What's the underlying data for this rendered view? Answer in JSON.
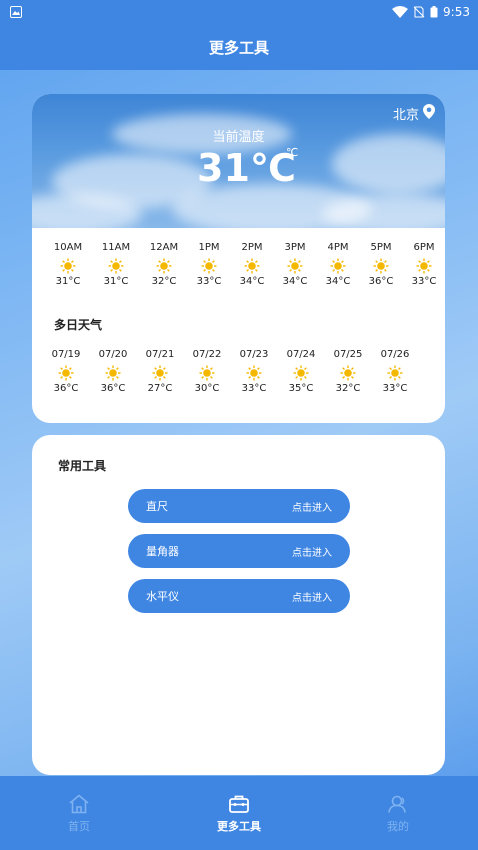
{
  "status_bar": {
    "time": "9:53"
  },
  "header": {
    "title": "更多工具"
  },
  "weather": {
    "city": "北京",
    "current_label": "当前温度",
    "current_temp": "31℃",
    "unit_small": "℃",
    "hourly": [
      {
        "time": "10AM",
        "temp": "31°C"
      },
      {
        "time": "11AM",
        "temp": "31°C"
      },
      {
        "time": "12AM",
        "temp": "32°C"
      },
      {
        "time": "1PM",
        "temp": "33°C"
      },
      {
        "time": "2PM",
        "temp": "34°C"
      },
      {
        "time": "3PM",
        "temp": "34°C"
      },
      {
        "time": "4PM",
        "temp": "34°C"
      },
      {
        "time": "5PM",
        "temp": "36°C"
      },
      {
        "time": "6PM",
        "temp": "33°C"
      }
    ],
    "multi_day_title": "多日天气",
    "daily": [
      {
        "date": "07/19",
        "temp": "36°C"
      },
      {
        "date": "07/20",
        "temp": "36°C"
      },
      {
        "date": "07/21",
        "temp": "27°C"
      },
      {
        "date": "07/22",
        "temp": "30°C"
      },
      {
        "date": "07/23",
        "temp": "33°C"
      },
      {
        "date": "07/24",
        "temp": "35°C"
      },
      {
        "date": "07/25",
        "temp": "32°C"
      },
      {
        "date": "07/26",
        "temp": "33°C"
      }
    ],
    "icon": "sun-icon"
  },
  "tools": {
    "title": "常用工具",
    "items": [
      {
        "name": "直尺",
        "action": "点击进入"
      },
      {
        "name": "量角器",
        "action": "点击进入"
      },
      {
        "name": "水平仪",
        "action": "点击进入"
      }
    ]
  },
  "nav": {
    "items": [
      {
        "label": "首页",
        "icon": "home-icon"
      },
      {
        "label": "更多工具",
        "icon": "toolbox-icon"
      },
      {
        "label": "我的",
        "icon": "profile-icon"
      }
    ]
  },
  "colors": {
    "primary": "#3f86e3",
    "sun": "#f5b800"
  }
}
